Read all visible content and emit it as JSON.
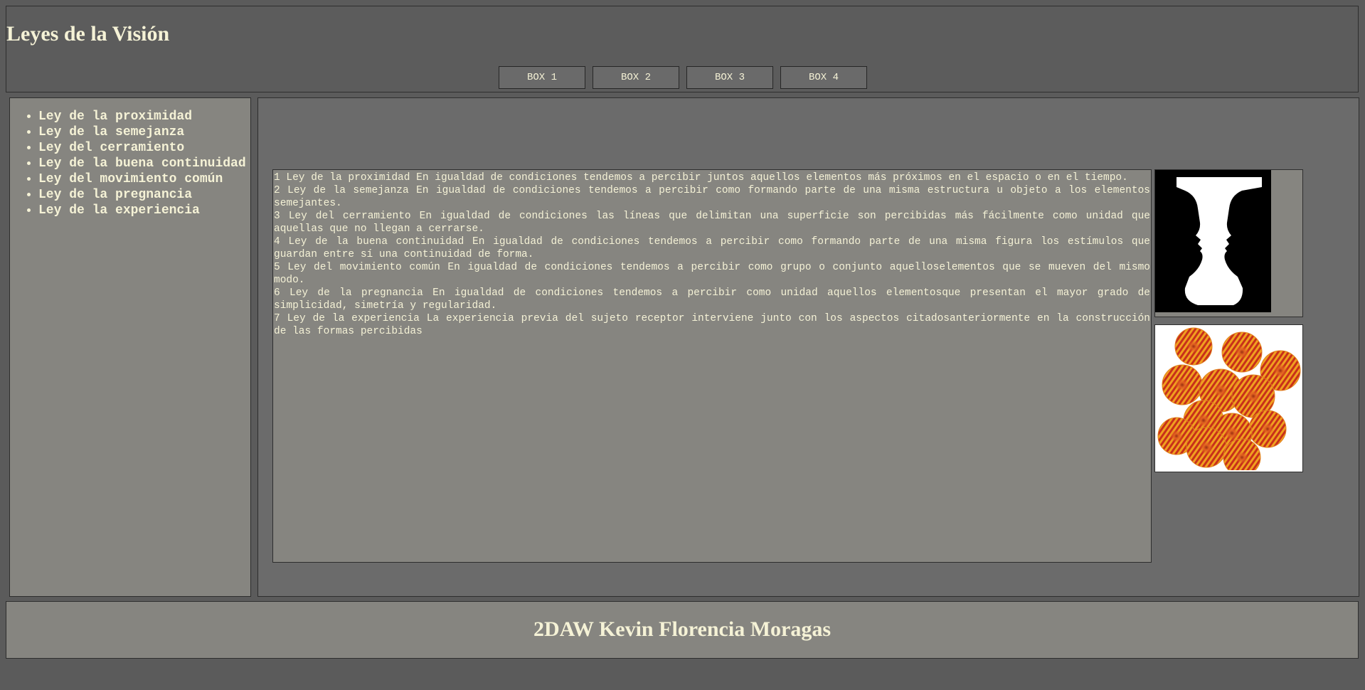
{
  "header": {
    "title": "Leyes de la Visión",
    "nav": [
      "BOX 1",
      "BOX 2",
      "BOX 3",
      "BOX 4"
    ]
  },
  "sidebar": {
    "items": [
      "Ley de la proximidad",
      "Ley de la semejanza",
      "Ley del cerramiento",
      "Ley de la buena continuidad",
      "Ley del movimiento común",
      "Ley de la pregnancia",
      "Ley de la experiencia"
    ]
  },
  "content": {
    "paragraphs": [
      "1 Ley de la proximidad En igualdad de condiciones tendemos a percibir juntos aquellos elementos más próximos en el espacio o en el tiempo.",
      "2 Ley de la semejanza En igualdad de condiciones tendemos a percibir como formando parte de una misma estructura u objeto a los elementos semejantes.",
      "3 Ley del cerramiento En igualdad de condiciones las líneas que delimitan una superficie son percibidas más fácilmente como unidad que aquellas que no llegan a cerrarse.",
      "4 Ley de la buena continuidad En igualdad de condiciones tendemos a percibir como formando parte de una misma figura los estímulos que guardan entre sí una continuidad de forma.",
      "5 Ley del movimiento común En igualdad de condiciones tendemos a percibir como grupo o conjunto aquelloselementos que se mueven del mismo modo.",
      "6 Ley de la pregnancia En igualdad de condiciones tendemos a percibir como unidad aquellos elementosque presentan el mayor grado de simplicidad, simetría y regularidad.",
      "7 Ley de la experiencia La experiencia previa del sujeto receptor interviene junto con los aspectos citadosanteriormente en la construcción de las formas percibidas"
    ]
  },
  "images": {
    "first": "rubin-vase-faces",
    "second": "rotating-circles-illusion"
  },
  "footer": {
    "text": "2DAW Kevin Florencia Moragas"
  },
  "colors": {
    "background": "#5b5b5b",
    "panel": "#868580",
    "main": "#6b6b6b",
    "text": "#f5f2d6",
    "border": "#2e2e2e"
  }
}
